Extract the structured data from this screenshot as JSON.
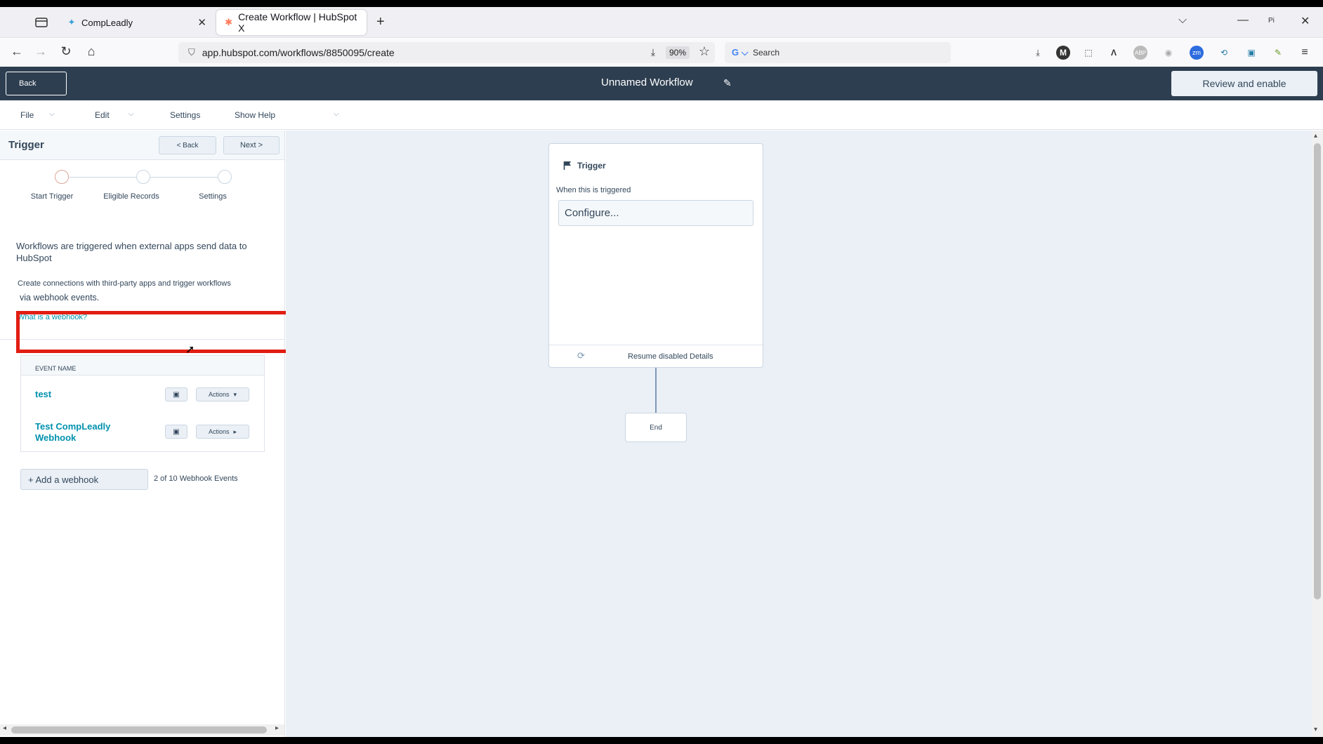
{
  "browser": {
    "tabs": [
      {
        "label": "CompLeadly",
        "active": false
      },
      {
        "label": "Create Workflow | HubSpot X",
        "active": true
      }
    ],
    "url": "app.hubspot.com/workflows/8850095/create",
    "zoom": "90%",
    "search_placeholder": "Search"
  },
  "header": {
    "back_label": "Back",
    "workflow_title": "Unnamed Workflow",
    "review_label": "Review and enable"
  },
  "menu": {
    "file": "File",
    "edit": "Edit",
    "settings": "Settings",
    "show_help": "Show Help"
  },
  "panel": {
    "title": "Trigger",
    "back_label": "< Back",
    "next_label": "Next >",
    "steps": [
      "Start Trigger",
      "Eligible Records",
      "Settings"
    ],
    "intro": "Workflows are triggered when external apps send data to HubSpot",
    "desc_line1": "Create connections with third-party apps and trigger workflows",
    "desc_line2": "via webhook events.",
    "webhook_link": "What is a webhook?",
    "table_header": "EVENT NAME",
    "events": [
      {
        "name": "test",
        "actions_label": "Actions"
      },
      {
        "name": "Test CompLeadly Webhook",
        "actions_label": "Actions"
      }
    ],
    "add_webhook": "+ Add a webhook",
    "event_count": "2 of 10 Webhook Events"
  },
  "canvas": {
    "trigger_title": "Trigger",
    "trigger_subtitle": "When this is triggered",
    "configure_placeholder": "Configure...",
    "resume_text": "Resume disabled Details",
    "end_label": "End"
  },
  "colors": {
    "header_bg": "#2d3e50",
    "link": "#0091ae",
    "highlight": "#e21d12",
    "canvas_bg": "#eaf0f6"
  }
}
